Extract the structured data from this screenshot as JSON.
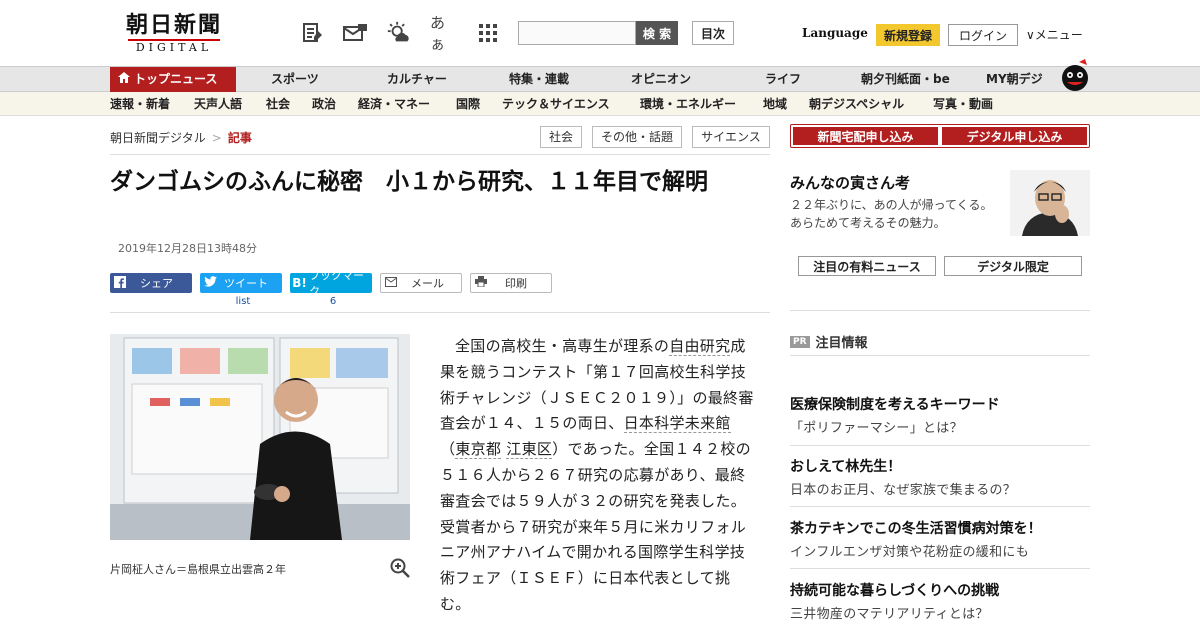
{
  "header": {
    "logo_main": "朝日新聞",
    "logo_sub": "DIGITAL",
    "search_button": "検 索",
    "toc_button": "目次",
    "language": "Language",
    "register": "新規登録",
    "login": "ログイン",
    "menu": "メニュー",
    "icons": [
      "newspaper-edit-icon",
      "mail-tag-icon",
      "weather-icon",
      "font-size-icon",
      "grid-menu-icon"
    ],
    "font_size_glyph": "あぁ"
  },
  "nav_primary": {
    "home": "トップニュース",
    "items": [
      "スポーツ",
      "カルチャー",
      "特集・連載",
      "オピニオン",
      "ライフ",
      "朝夕刊紙面・be",
      "MY朝デジ"
    ]
  },
  "nav_secondary": {
    "items": [
      "速報・新着",
      "天声人語",
      "社会",
      "政治",
      "経済・マネー",
      "国際",
      "テック＆サイエンス",
      "環境・エネルギー",
      "地域",
      "朝デジスペシャル",
      "写真・動画"
    ]
  },
  "breadcrumb": {
    "root": "朝日新聞デジタル",
    "separator": ">",
    "current": "記事"
  },
  "tags": [
    "社会",
    "その他・話題",
    "サイエンス"
  ],
  "article": {
    "headline": "ダンゴムシのふんに秘密　小１から研究、１１年目で解明",
    "date": "2019年12月28日13時48分",
    "share": {
      "facebook": "シェア",
      "twitter": "ツイート",
      "twitter_count": "list",
      "hatena": "ブックマーク",
      "hatena_count": "6",
      "mail": "メール",
      "print": "印刷"
    },
    "photo_caption": "片岡柾人さん＝島根県立出雲高２年",
    "body_segments": [
      {
        "t": "全国の高校生・高専生が理系の",
        "kw": false
      },
      {
        "t": "自由研究",
        "kw": true
      },
      {
        "t": "成果を競うコンテスト「第１７回高校生科学技術チャレンジ（ＪＳＥＣ２０１９）」の最終審査会が１４、１５の両日、",
        "kw": false
      },
      {
        "t": "日本科学未来館",
        "kw": true
      },
      {
        "t": "（",
        "kw": false
      },
      {
        "t": "東京都",
        "kw": true
      },
      {
        "t": "江東区",
        "kw": true
      },
      {
        "t": "）であった。全国１４２校の５１６人から２６７研究の応募があり、最終審査会では５９人が３２の研究を発表した。受賞者から７研究が来年５月に米カリフォルニア州アナハイムで開かれる国際学生科学技術フェア（ＩＳＥＦ）に日本代表として挑む。",
        "kw": false
      }
    ]
  },
  "sidebar": {
    "subscribe_paper": "新聞宅配申し込み",
    "subscribe_digital": "デジタル申し込み",
    "feature_title": "みんなの寅さん考",
    "feature_desc": "２２年ぶりに、あの人が帰ってくる。あらためて考えるその魅力。",
    "tab_paid": "注目の有料ニュース",
    "tab_digital": "デジタル限定",
    "pr_badge": "PR",
    "pr_title": "注目情報",
    "ads": [
      {
        "title": "医療保険制度を考えるキーワード",
        "sub": "「ポリファーマシー」とは？"
      },
      {
        "title": "おしえて林先生！",
        "sub": "日本のお正月、なぜ家族で集まるの？"
      },
      {
        "title": "茶カテキンでこの冬生活習慣病対策を！",
        "sub": "インフルエンザ対策や花粉症の緩和にも"
      },
      {
        "title": "持続可能な暮らしづくりへの挑戦",
        "sub": "三井物産のマテリアリティとは？"
      }
    ]
  },
  "colors": {
    "brand_red": "#b31e1e",
    "register_yellow": "#f3c72e",
    "facebook": "#3b5998",
    "twitter": "#1da1f2",
    "hatena": "#00a4de"
  }
}
